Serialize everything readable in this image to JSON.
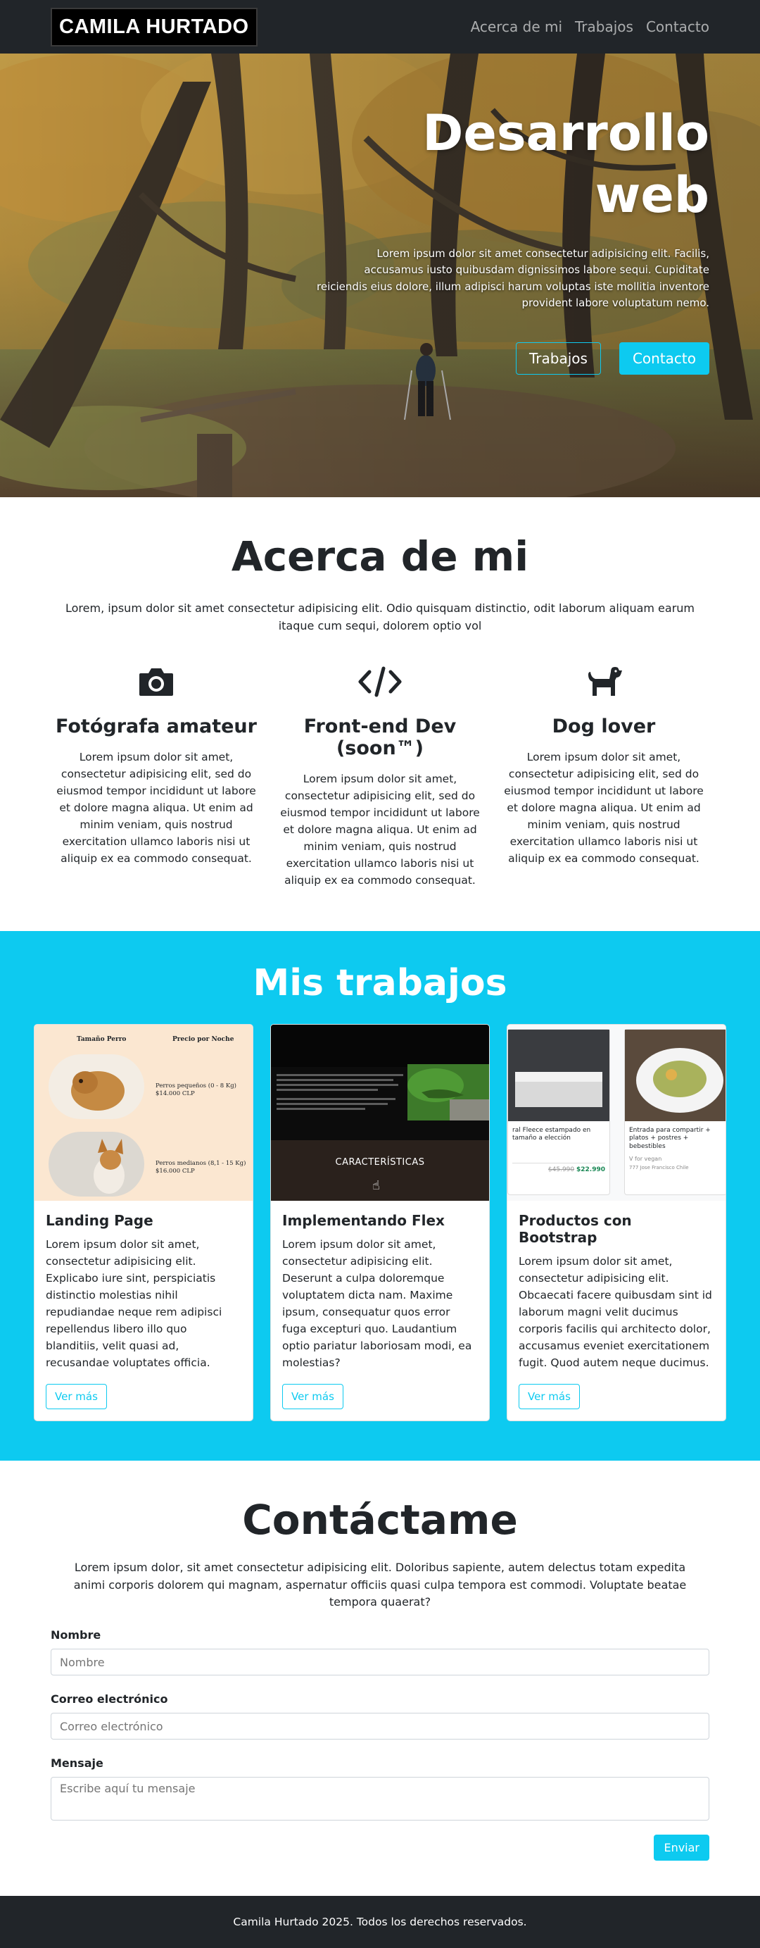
{
  "navbar": {
    "brand": "CAMILA HURTADO",
    "links": [
      "Acerca de mi",
      "Trabajos",
      "Contacto"
    ]
  },
  "hero": {
    "title_line1": "Desarrollo",
    "title_line2": "web",
    "text": "Lorem ipsum dolor sit amet consectetur adipisicing elit. Facilis, accusamus iusto quibusdam dignissimos labore sequi. Cupiditate reiciendis eius dolore, illum adipisci harum voluptas iste mollitia inventore provident labore voluptatum nemo.",
    "btn_works": "Trabajos",
    "btn_contact": "Contacto"
  },
  "about": {
    "title": "Acerca de mi",
    "lead": "Lorem, ipsum dolor sit amet consectetur adipisicing elit. Odio quisquam distinctio, odit laborum aliquam earum itaque cum sequi, dolorem optio vol",
    "features": [
      {
        "icon": "camera-icon",
        "title": "Fotógrafa amateur",
        "text": "Lorem ipsum dolor sit amet, consectetur adipisicing elit, sed do eiusmod tempor incididunt ut labore et dolore magna aliqua. Ut enim ad minim veniam, quis nostrud exercitation ullamco laboris nisi ut aliquip ex ea commodo consequat."
      },
      {
        "icon": "code-icon",
        "title": "Front-end Dev (soon™)",
        "text": "Lorem ipsum dolor sit amet, consectetur adipisicing elit, sed do eiusmod tempor incididunt ut labore et dolore magna aliqua. Ut enim ad minim veniam, quis nostrud exercitation ullamco laboris nisi ut aliquip ex ea commodo consequat."
      },
      {
        "icon": "dog-icon",
        "title": "Dog lover",
        "text": "Lorem ipsum dolor sit amet, consectetur adipisicing elit, sed do eiusmod tempor incididunt ut labore et dolore magna aliqua. Ut enim ad minim veniam, quis nostrud exercitation ullamco laboris nisi ut aliquip ex ea commodo consequat."
      }
    ]
  },
  "works": {
    "title": "Mis trabajos",
    "cards": [
      {
        "title": "Landing Page",
        "text": "Lorem ipsum dolor sit amet, consectetur adipisicing elit. Explicabo iure sint, perspiciatis distinctio molestias nihil repudiandae neque rem adipisci repellendus libero illo quo blanditiis, velit quasi ad, recusandae voluptates officia.",
        "button": "Ver más",
        "preview": {
          "col1": "Tamaño Perro",
          "col2": "Precio por Noche",
          "row1_size": "Perros pequeños (0 - 8 Kg)",
          "row1_price": "$14.000 CLP",
          "row2_size": "Perros medianos (8,1 - 15 Kg)",
          "row2_price": "$16.000 CLP"
        }
      },
      {
        "title": "Implementando Flex",
        "text": "Lorem ipsum dolor sit amet, consectetur adipisicing elit. Deserunt a culpa doloremque voluptatem dicta nam. Maxime ipsum, consequatur quos error fuga excepturi quo. Laudantium optio pariatur laboriosam modi, ea molestias?",
        "button": "Ver más",
        "preview": {
          "caption": "CARACTERÍSTICAS"
        }
      },
      {
        "title": "Productos con Bootstrap",
        "text": "Lorem ipsum dolor sit amet, consectetur adipisicing elit. Obcaecati facere quibusdam sint id laborum magni velit ducimus corporis facilis qui architecto dolor, accusamus eveniet exercitationem fugit. Quod autem neque ducimus.",
        "button": "Ver más",
        "preview": {
          "product1": "ral Fleece estampado en tamaño a elección",
          "product1_price_old": "$45.990",
          "product1_price": "$22.990",
          "product2": "Entrada para compartir + platos + postres + bebestibles",
          "product2_tag": "V for vegan",
          "product2_loc": "777 Jose Francisco Chile"
        }
      }
    ]
  },
  "contact": {
    "title": "Contáctame",
    "lead": "Lorem ipsum dolor, sit amet consectetur adipisicing elit. Doloribus sapiente, autem delectus totam expedita animi corporis dolorem qui magnam, aspernatur officiis quasi culpa tempora est commodi. Voluptate beatae tempora quaerat?",
    "name_label": "Nombre",
    "name_placeholder": "Nombre",
    "email_label": "Correo electrónico",
    "email_placeholder": "Correo electrónico",
    "message_label": "Mensaje",
    "message_placeholder": "Escribe aquí tu mensaje",
    "send": "Enviar"
  },
  "footer": {
    "text": "Camila Hurtado 2025. Todos los derechos reservados."
  },
  "colors": {
    "accent": "#0dcaf0",
    "dark": "#212529"
  }
}
